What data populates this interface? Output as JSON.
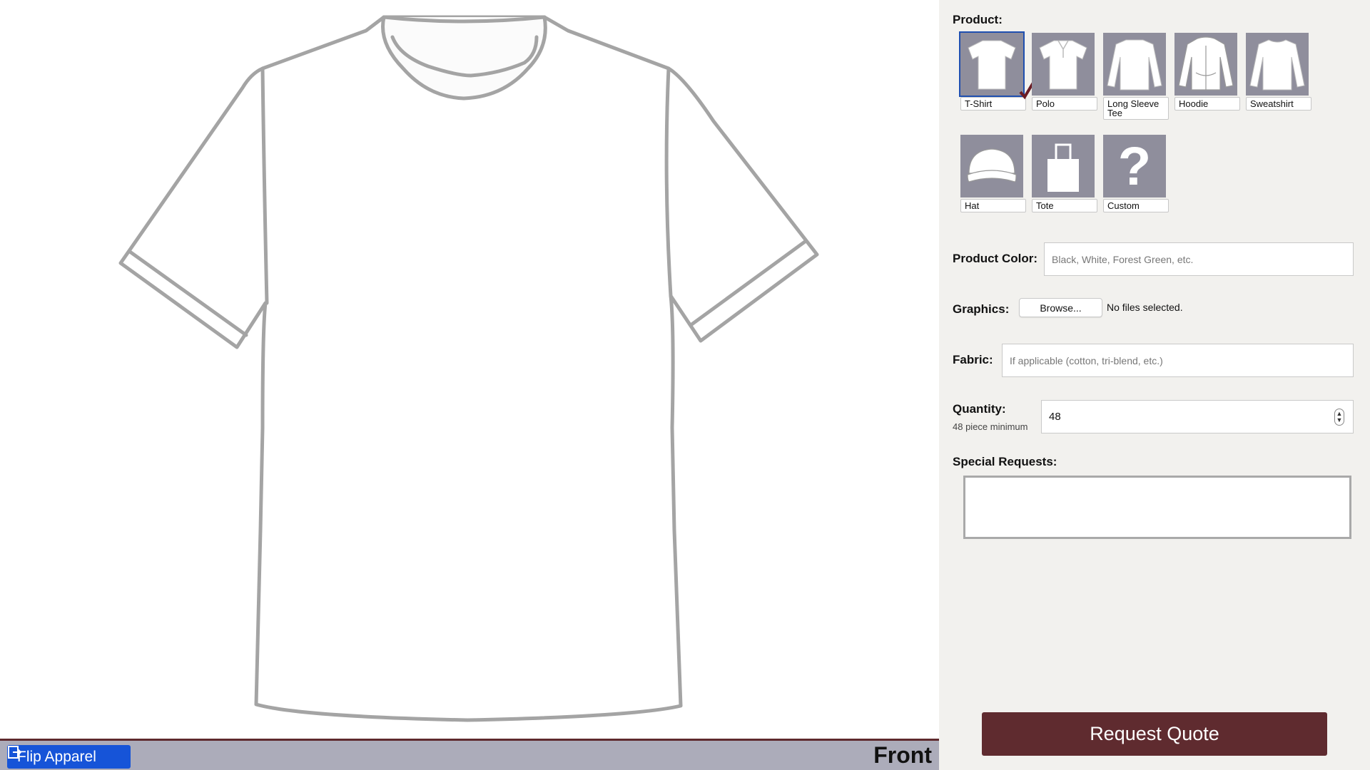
{
  "canvas": {
    "flip_label": "Flip Apparel",
    "view_label": "Front"
  },
  "panel": {
    "product_label": "Product:",
    "products": [
      {
        "label": "T-Shirt",
        "selected": true
      },
      {
        "label": "Polo",
        "selected": false
      },
      {
        "label": "Long Sleeve Tee",
        "selected": false
      },
      {
        "label": "Hoodie",
        "selected": false
      },
      {
        "label": "Sweatshirt",
        "selected": false
      },
      {
        "label": "Hat",
        "selected": false
      },
      {
        "label": "Tote",
        "selected": false
      },
      {
        "label": "Custom",
        "selected": false
      }
    ],
    "color_label": "Product Color:",
    "color_placeholder": "Black, White, Forest Green, etc.",
    "graphics_label": "Graphics:",
    "browse_label": "Browse...",
    "file_status": "No files selected.",
    "fabric_label": "Fabric:",
    "fabric_placeholder": "If applicable (cotton, tri-blend, etc.)",
    "quantity_label": "Quantity:",
    "quantity_hint": "48 piece minimum",
    "quantity_value": "48",
    "special_label": "Special Requests:",
    "special_value": "",
    "quote_label": "Request Quote"
  },
  "colors": {
    "accent_maroon": "#5f2b2f",
    "flip_blue": "#1654d8",
    "thumb_gray": "#8f8e9c",
    "bar_gray": "#acacba"
  }
}
